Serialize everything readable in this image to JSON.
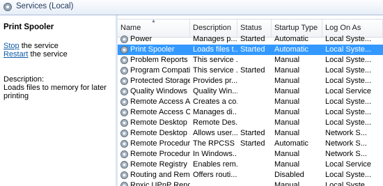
{
  "window": {
    "title": "Services (Local)"
  },
  "left_pane": {
    "service_name": "Print Spooler",
    "stop_link": "Stop",
    "stop_suffix": " the service",
    "restart_link": "Restart",
    "restart_suffix": " the service",
    "description_label": "Description:",
    "description_text": "Loads files to memory for later printing"
  },
  "columns": [
    "Name",
    "Description",
    "Status",
    "Startup Type",
    "Log On As"
  ],
  "rows": [
    {
      "name": "Power",
      "description": "Manages p...",
      "status": "Started",
      "startup": "Automatic",
      "logon": "Local Syste..."
    },
    {
      "name": "Print Spooler",
      "description": "Loads files t...",
      "status": "Started",
      "startup": "Automatic",
      "logon": "Local Syste...",
      "selected": true
    },
    {
      "name": "Problem Reports a...",
      "description": "This service ...",
      "status": "",
      "startup": "Manual",
      "logon": "Local Syste..."
    },
    {
      "name": "Program Compati...",
      "description": "This service ...",
      "status": "Started",
      "startup": "Manual",
      "logon": "Local Syste..."
    },
    {
      "name": "Protected Storage",
      "description": "Provides pr...",
      "status": "",
      "startup": "Manual",
      "logon": "Local Syste..."
    },
    {
      "name": "Quality Windows ...",
      "description": "Quality Win...",
      "status": "",
      "startup": "Manual",
      "logon": "Local Service"
    },
    {
      "name": "Remote Access A...",
      "description": "Creates a co...",
      "status": "",
      "startup": "Manual",
      "logon": "Local Syste..."
    },
    {
      "name": "Remote Access C...",
      "description": "Manages di...",
      "status": "",
      "startup": "Manual",
      "logon": "Local Syste..."
    },
    {
      "name": "Remote Desktop ...",
      "description": "Remote Des...",
      "status": "",
      "startup": "Manual",
      "logon": "Local Syste..."
    },
    {
      "name": "Remote Desktop S...",
      "description": "Allows user...",
      "status": "Started",
      "startup": "Manual",
      "logon": "Network S..."
    },
    {
      "name": "Remote Procedur...",
      "description": "The RPCSS ...",
      "status": "Started",
      "startup": "Automatic",
      "logon": "Network S..."
    },
    {
      "name": "Remote Procedur...",
      "description": "In Windows...",
      "status": "",
      "startup": "Manual",
      "logon": "Network S..."
    },
    {
      "name": "Remote Registry",
      "description": "Enables rem...",
      "status": "",
      "startup": "Manual",
      "logon": "Local Service"
    },
    {
      "name": "Routing and Rem...",
      "description": "Offers routi...",
      "status": "",
      "startup": "Disabled",
      "logon": "Local Syste..."
    },
    {
      "name": "Rpxic UPnP Rendo...",
      "description": "",
      "status": "",
      "startup": "Manual",
      "logon": "Local Syste..."
    }
  ]
}
